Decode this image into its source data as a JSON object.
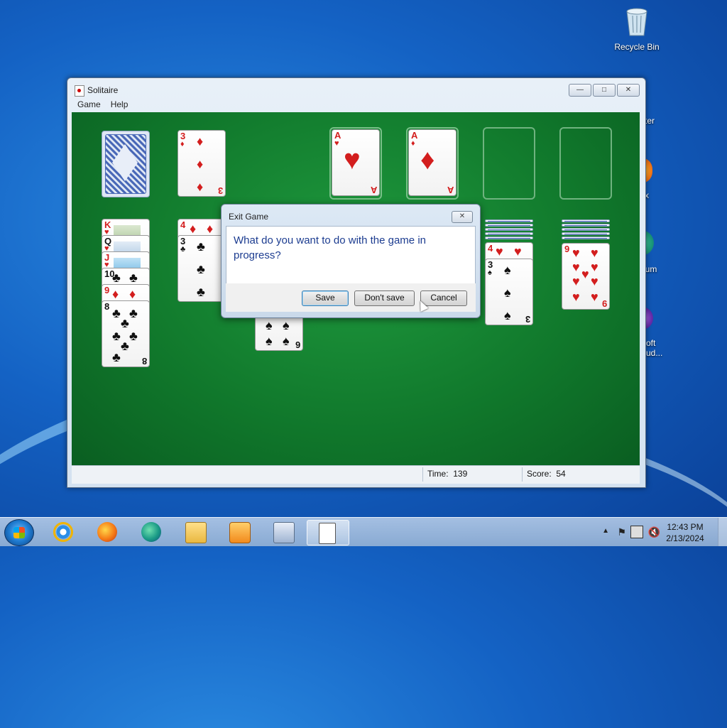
{
  "desktop": {
    "recycle_bin": "Recycle Bin",
    "partial_labels": [
      "ter",
      "x",
      "ium",
      "oft",
      "ud..."
    ]
  },
  "window": {
    "title": "Solitaire",
    "menu": [
      "Game",
      "Help"
    ],
    "status": {
      "time_label": "Time:",
      "time": "139",
      "score_label": "Score:",
      "score": "54"
    }
  },
  "cards": {
    "waste_top": {
      "rank": "3",
      "suit": "♦"
    },
    "foundation_1": {
      "rank": "A",
      "suit": "♥"
    },
    "foundation_2": {
      "rank": "A",
      "suit": "♦"
    },
    "col1": [
      {
        "rank": "K",
        "suit": "♥"
      },
      {
        "rank": "Q",
        "suit": "♥"
      },
      {
        "rank": "J",
        "suit": "♥"
      },
      {
        "rank": "10",
        "suit": "♣"
      },
      {
        "rank": "9",
        "suit": "♦"
      },
      {
        "rank": "8",
        "suit": "♣"
      }
    ],
    "col2": [
      {
        "rank": "4",
        "suit": "♦"
      },
      {
        "rank": "3",
        "suit": "♣"
      }
    ],
    "col3_bottom": {
      "rank": "6",
      "suit": "♠"
    },
    "col6": [
      {
        "rank": "4",
        "suit": "♥"
      },
      {
        "rank": "3",
        "suit": "♠"
      }
    ],
    "col7": [
      {
        "rank": "9",
        "suit": "♥"
      }
    ]
  },
  "dialog": {
    "title": "Exit Game",
    "close": "✕",
    "message": "What do you want to do with the game in progress?",
    "buttons": {
      "save": "Save",
      "dont_save": "Don't save",
      "cancel": "Cancel"
    }
  },
  "taskbar": {
    "clock_time": "12:43 PM",
    "clock_date": "2/13/2024",
    "pinned": [
      "internet-explorer",
      "firefox",
      "edge",
      "file-explorer",
      "media-player",
      "solitaire-games",
      "solitaire"
    ]
  },
  "colors": {
    "felt": "#10772b",
    "dialog_text": "#1c3c90",
    "red_suit": "#d31e1e"
  }
}
